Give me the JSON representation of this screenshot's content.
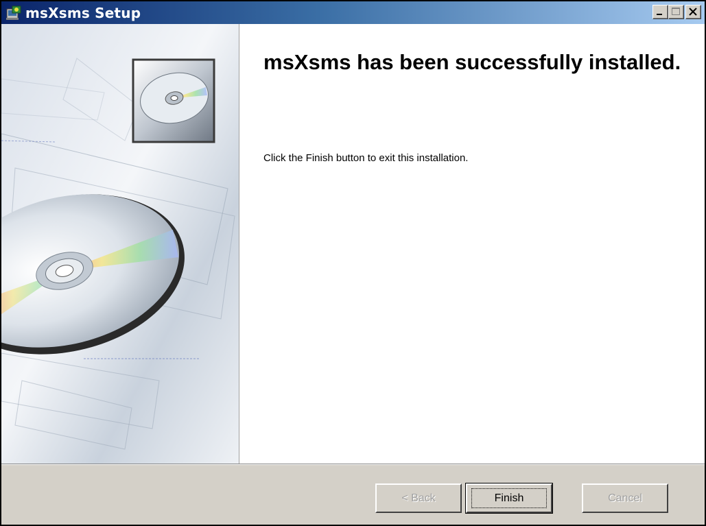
{
  "window": {
    "title": "msXsms Setup",
    "controls": [
      "minimize-icon",
      "maximize-icon",
      "close-icon"
    ]
  },
  "main": {
    "heading": "msXsms has been successfully installed.",
    "message": "Click the Finish button to exit this installation."
  },
  "buttons": {
    "back": {
      "label": "< Back",
      "enabled": false
    },
    "finish": {
      "label": "Finish",
      "enabled": true,
      "default": true
    },
    "cancel": {
      "label": "Cancel",
      "enabled": false
    }
  },
  "colors": {
    "titlebar_start": "#0a246a",
    "titlebar_end": "#a6caf0",
    "dialog_face": "#d4d0c8"
  },
  "icons": [
    "setup-app-icon",
    "cd-disc-icon"
  ]
}
